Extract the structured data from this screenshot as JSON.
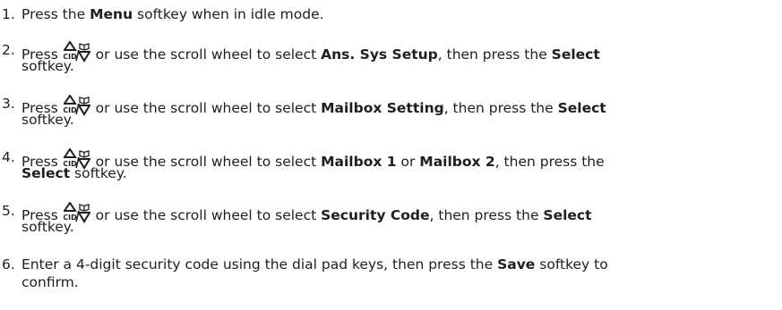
{
  "steps": [
    {
      "num": "1.",
      "t1": "Press the ",
      "b1": "Menu",
      "t2": " softkey when in idle mode."
    },
    {
      "num": "2.",
      "t1": "Press ",
      "icon": "cid-up-down-phonebook-key-icon",
      "t2": " or use the scroll wheel to select ",
      "b1": "Ans. Sys Setup",
      "t3": ", then press the ",
      "b2": "Select",
      "l2": "softkey."
    },
    {
      "num": "3.",
      "t1": "Press ",
      "icon": "cid-up-down-phonebook-key-icon",
      "t2": " or use the scroll wheel to select ",
      "b1": "Mailbox Setting",
      "t3": ", then press the ",
      "b2": "Select",
      "l2": "softkey."
    },
    {
      "num": "4.",
      "t1": "Press ",
      "icon": "cid-up-down-phonebook-key-icon",
      "t2": " or use the scroll wheel to select ",
      "b1": "Mailbox 1",
      "t3": " or ",
      "b2": "Mailbox 2",
      "t4": ", then press the",
      "l2b": "Select",
      "l2": " softkey."
    },
    {
      "num": "5.",
      "t1": "Press ",
      "icon": "cid-up-down-phonebook-key-icon",
      "t2": " or use the scroll wheel to select ",
      "b1": "Security Code",
      "t3": ", then press the ",
      "b2": "Select",
      "l2": "softkey."
    },
    {
      "num": "6.",
      "t1": "Enter a 4-digit security code using the dial pad keys, then press the ",
      "b1": "Save",
      "t2": " softkey to",
      "l2": "confirm."
    }
  ],
  "icon_text": "CID",
  "text_color": "#1e1e1e"
}
